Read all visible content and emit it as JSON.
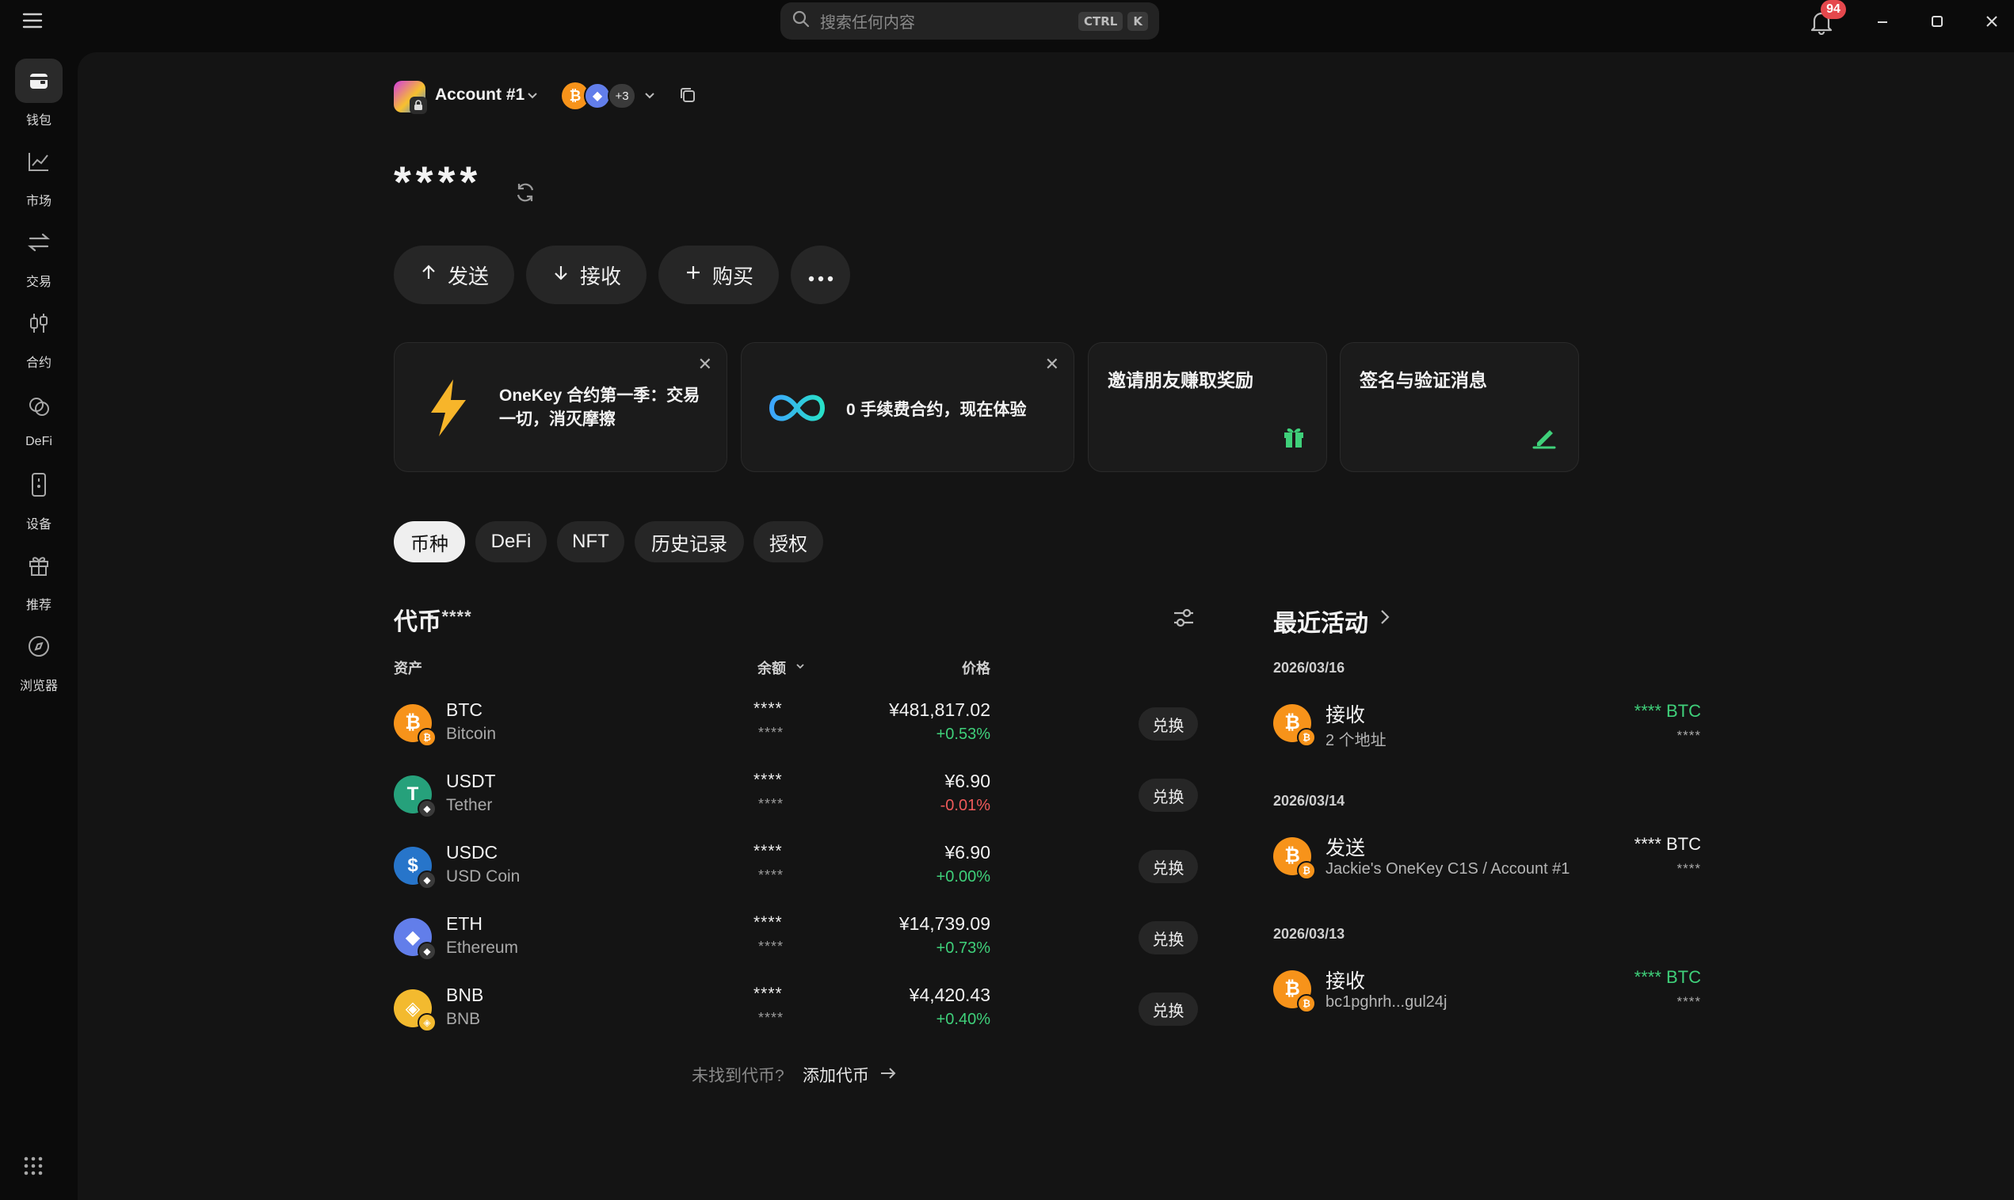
{
  "search": {
    "placeholder": "搜索任何内容",
    "key1": "CTRL",
    "key2": "K"
  },
  "notifications": {
    "count": "94"
  },
  "sidebar": {
    "items": [
      {
        "label": "钱包",
        "icon": "wallet-icon"
      },
      {
        "label": "市场",
        "icon": "chart-icon"
      },
      {
        "label": "交易",
        "icon": "swap-arrows-icon"
      },
      {
        "label": "合约",
        "icon": "candles-icon"
      },
      {
        "label": "DeFi",
        "icon": "defi-icon"
      },
      {
        "label": "设备",
        "icon": "device-icon"
      },
      {
        "label": "推荐",
        "icon": "gift-icon"
      },
      {
        "label": "浏览器",
        "icon": "compass-icon"
      }
    ]
  },
  "account": {
    "name": "Account #1",
    "networks_more": "+3"
  },
  "balance": {
    "masked": "****"
  },
  "actions": {
    "send": "发送",
    "receive": "接收",
    "buy": "购买"
  },
  "promos": {
    "contract": "OneKey 合约第一季：交易一切，消灭摩擦",
    "zero_fee": "0 手续费合约，现在体验",
    "invite": "邀请朋友赚取奖励",
    "sign": "签名与验证消息"
  },
  "tabs": [
    "币种",
    "DeFi",
    "NFT",
    "历史记录",
    "授权"
  ],
  "tokens": {
    "title": "代币",
    "title_masked": "· ****",
    "col_asset": "资产",
    "col_balance": "余额",
    "col_price": "价格",
    "swap_label": "兑换",
    "rows": [
      {
        "symbol": "BTC",
        "name": "Bitcoin",
        "bal": "****",
        "bal2": "****",
        "price": "¥481,817.02",
        "change": "+0.53%",
        "dir": "up",
        "color": "#f7931a",
        "glyph": "₿"
      },
      {
        "symbol": "USDT",
        "name": "Tether",
        "bal": "****",
        "bal2": "****",
        "price": "¥6.90",
        "change": "-0.01%",
        "dir": "down",
        "color": "#26a17b",
        "glyph": "T"
      },
      {
        "symbol": "USDC",
        "name": "USD Coin",
        "bal": "****",
        "bal2": "****",
        "price": "¥6.90",
        "change": "+0.00%",
        "dir": "up",
        "color": "#2775ca",
        "glyph": "$"
      },
      {
        "symbol": "ETH",
        "name": "Ethereum",
        "bal": "****",
        "bal2": "****",
        "price": "¥14,739.09",
        "change": "+0.73%",
        "dir": "up",
        "color": "#627eea",
        "glyph": "◆"
      },
      {
        "symbol": "BNB",
        "name": "BNB",
        "bal": "****",
        "bal2": "****",
        "price": "¥4,420.43",
        "change": "+0.40%",
        "dir": "up",
        "color": "#f3ba2f",
        "glyph": "◈"
      }
    ],
    "not_found": "未找到代币?",
    "add_token": "添加代币"
  },
  "activity": {
    "title": "最近活动",
    "groups": [
      {
        "date": "2026/03/16",
        "type": "接收",
        "sub": "2 个地址",
        "amount": "**** BTC",
        "amount2": "****",
        "incoming": true
      },
      {
        "date": "2026/03/14",
        "type": "发送",
        "sub": "Jackie's OneKey C1S / Account #1",
        "amount": "**** BTC",
        "amount2": "****",
        "incoming": false
      },
      {
        "date": "2026/03/13",
        "type": "接收",
        "sub": "bc1pghrh...gul24j",
        "amount": "**** BTC",
        "amount2": "****",
        "incoming": true
      }
    ]
  },
  "colors": {
    "accent_up": "#3fd07a",
    "accent_down": "#f05a5a",
    "badge_red": "#e5484d"
  }
}
